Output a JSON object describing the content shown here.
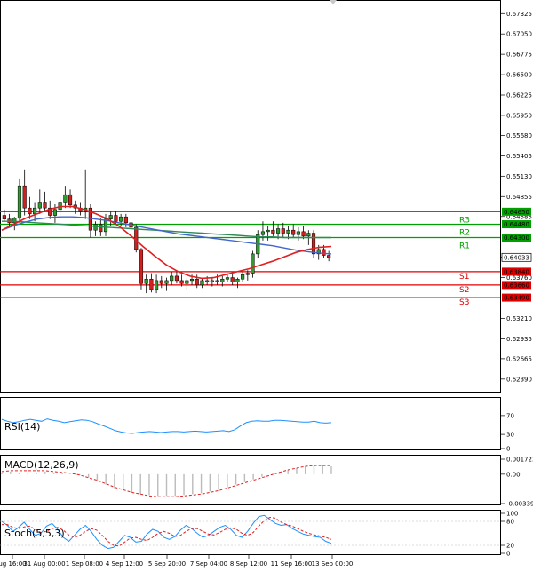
{
  "chart_data": {
    "type": "candlestick",
    "main": {
      "y_ticks": [
        "0.67325",
        "0.67050",
        "0.66775",
        "0.66500",
        "0.66225",
        "0.65950",
        "0.65680",
        "0.65405",
        "0.65130",
        "0.64855",
        "0.64585",
        "0.64035",
        "0.63760",
        "0.63210",
        "0.62935",
        "0.62665",
        "0.62390"
      ],
      "ylim": [
        0.6228,
        0.6746
      ],
      "x_ticks": [
        "ug 16:00",
        "31 Aug 00:00",
        "1 Sep 08:00",
        "4 Sep 12:00",
        "5 Sep 20:00",
        "7 Sep 04:00",
        "8 Sep 12:00",
        "11 Sep 16:00",
        "13 Sep 00:00"
      ],
      "last_price": "0.64033",
      "candles": [
        [
          0.646,
          0.6468,
          0.6452,
          0.6455
        ],
        [
          0.6455,
          0.6462,
          0.6446,
          0.645
        ],
        [
          0.645,
          0.6458,
          0.644,
          0.6456
        ],
        [
          0.6456,
          0.651,
          0.645,
          0.65
        ],
        [
          0.65,
          0.6522,
          0.646,
          0.647
        ],
        [
          0.647,
          0.6485,
          0.6455,
          0.6462
        ],
        [
          0.6462,
          0.6478,
          0.6452,
          0.647
        ],
        [
          0.647,
          0.6495,
          0.6462,
          0.6478
        ],
        [
          0.6478,
          0.6492,
          0.6465,
          0.647
        ],
        [
          0.647,
          0.648,
          0.6455,
          0.646
        ],
        [
          0.646,
          0.6475,
          0.645,
          0.6468
        ],
        [
          0.6468,
          0.6485,
          0.646,
          0.6478
        ],
        [
          0.6478,
          0.65,
          0.647,
          0.6488
        ],
        [
          0.6488,
          0.6495,
          0.647,
          0.6474
        ],
        [
          0.6474,
          0.648,
          0.6462,
          0.647
        ],
        [
          0.647,
          0.6478,
          0.646,
          0.6465
        ],
        [
          0.6465,
          0.6522,
          0.6455,
          0.647
        ],
        [
          0.647,
          0.6475,
          0.643,
          0.644
        ],
        [
          0.644,
          0.6452,
          0.6432,
          0.6448
        ],
        [
          0.6448,
          0.6456,
          0.6432,
          0.6438
        ],
        [
          0.6438,
          0.6462,
          0.6432,
          0.6455
        ],
        [
          0.6455,
          0.6465,
          0.6445,
          0.646
        ],
        [
          0.646,
          0.6466,
          0.6448,
          0.6452
        ],
        [
          0.6452,
          0.6462,
          0.6446,
          0.6458
        ],
        [
          0.6458,
          0.6462,
          0.6444,
          0.645
        ],
        [
          0.645,
          0.6455,
          0.6438,
          0.6444
        ],
        [
          0.6444,
          0.6448,
          0.641,
          0.6414
        ],
        [
          0.6414,
          0.6416,
          0.636,
          0.6368
        ],
        [
          0.6368,
          0.638,
          0.6355,
          0.6374
        ],
        [
          0.6374,
          0.6382,
          0.6356,
          0.636
        ],
        [
          0.636,
          0.638,
          0.6355,
          0.6372
        ],
        [
          0.6372,
          0.6378,
          0.6362,
          0.6368
        ],
        [
          0.6368,
          0.6376,
          0.6358,
          0.6372
        ],
        [
          0.6372,
          0.6384,
          0.6366,
          0.6378
        ],
        [
          0.6378,
          0.6384,
          0.6368,
          0.6372
        ],
        [
          0.6372,
          0.638,
          0.6364,
          0.6368
        ],
        [
          0.6368,
          0.6376,
          0.636,
          0.6372
        ],
        [
          0.6372,
          0.638,
          0.6366,
          0.6374
        ],
        [
          0.6374,
          0.638,
          0.6362,
          0.6366
        ],
        [
          0.6366,
          0.6376,
          0.6362,
          0.6372
        ],
        [
          0.6372,
          0.6378,
          0.6366,
          0.637
        ],
        [
          0.637,
          0.6376,
          0.6364,
          0.6372
        ],
        [
          0.6372,
          0.638,
          0.6366,
          0.637
        ],
        [
          0.637,
          0.6378,
          0.6364,
          0.6374
        ],
        [
          0.6374,
          0.638,
          0.637,
          0.6376
        ],
        [
          0.6376,
          0.6382,
          0.6366,
          0.637
        ],
        [
          0.637,
          0.6376,
          0.6362,
          0.6374
        ],
        [
          0.6374,
          0.6384,
          0.637,
          0.638
        ],
        [
          0.638,
          0.6386,
          0.6372,
          0.6382
        ],
        [
          0.6382,
          0.6412,
          0.6376,
          0.6408
        ],
        [
          0.6408,
          0.644,
          0.6402,
          0.6434
        ],
        [
          0.6434,
          0.6452,
          0.6426,
          0.6438
        ],
        [
          0.6438,
          0.6446,
          0.6426,
          0.644
        ],
        [
          0.644,
          0.6452,
          0.6432,
          0.6436
        ],
        [
          0.6436,
          0.6448,
          0.6428,
          0.6442
        ],
        [
          0.6442,
          0.645,
          0.643,
          0.6436
        ],
        [
          0.6436,
          0.6446,
          0.6428,
          0.644
        ],
        [
          0.644,
          0.6448,
          0.643,
          0.6434
        ],
        [
          0.6434,
          0.6444,
          0.6426,
          0.6438
        ],
        [
          0.6438,
          0.6446,
          0.6428,
          0.6432
        ],
        [
          0.6432,
          0.644,
          0.642,
          0.6436
        ],
        [
          0.6436,
          0.644,
          0.6402,
          0.6408
        ],
        [
          0.6408,
          0.642,
          0.64,
          0.6414
        ],
        [
          0.6414,
          0.642,
          0.6402,
          0.6406
        ],
        [
          0.6406,
          0.6412,
          0.6398,
          0.6403
        ]
      ],
      "sma_red": [
        0.644,
        0.6448,
        0.6456,
        0.6462,
        0.6468,
        0.6472,
        0.6472,
        0.6468,
        0.6462,
        0.6455,
        0.6445,
        0.6432,
        0.6418,
        0.6405,
        0.6393,
        0.6384,
        0.6378,
        0.6375,
        0.6376,
        0.638,
        0.6384,
        0.6388,
        0.6393,
        0.6398,
        0.6404,
        0.641,
        0.6414,
        0.6417,
        0.6418
      ],
      "sma_blue": [
        0.644,
        0.6446,
        0.6451,
        0.6455,
        0.6457,
        0.6458,
        0.6458,
        0.6457,
        0.6455,
        0.6453,
        0.645,
        0.6447,
        0.6444,
        0.6441,
        0.6438,
        0.6435,
        0.6433,
        0.6431,
        0.6429,
        0.6427,
        0.6425,
        0.6423,
        0.6421,
        0.6419,
        0.6416,
        0.6413,
        0.6411,
        0.6409,
        0.6408
      ],
      "sma_green": [
        0.6452,
        0.6452,
        0.6451,
        0.645,
        0.6449,
        0.6448,
        0.6447,
        0.6446,
        0.6445,
        0.6444,
        0.6443,
        0.6442,
        0.6441,
        0.644,
        0.6439,
        0.6438,
        0.6437,
        0.6436,
        0.6435,
        0.6434,
        0.6433,
        0.6432,
        0.6431,
        0.6431,
        0.643,
        0.643,
        0.643,
        0.643,
        0.643
      ],
      "levels": [
        {
          "name": "R3",
          "value": 0.6465,
          "tag": "0.64650",
          "color": "#00a000"
        },
        {
          "name": "R2",
          "value": 0.6448,
          "tag": "0.64480",
          "color": "#00a000"
        },
        {
          "name": "R1",
          "value": 0.643,
          "tag": "0.64300",
          "color": "#00a000"
        },
        {
          "name": "S1",
          "value": 0.6384,
          "tag": "0.63840",
          "color": "#e00000"
        },
        {
          "name": "S2",
          "value": 0.6366,
          "tag": "0.63660",
          "color": "#e00000"
        },
        {
          "name": "S3",
          "value": 0.6349,
          "tag": "0.63490",
          "color": "#e00000"
        }
      ]
    },
    "rsi": {
      "label": "RSI(14)",
      "ticks": [
        "70",
        "30",
        "0"
      ],
      "tick_values": [
        70,
        30,
        0
      ],
      "ylim": [
        0,
        100
      ],
      "values": [
        62,
        58,
        55,
        57,
        60,
        62,
        60,
        58,
        63,
        60,
        58,
        55,
        57,
        59,
        61,
        60,
        57,
        52,
        48,
        43,
        38,
        35,
        33,
        32,
        34,
        35,
        36,
        35,
        34,
        35,
        36,
        36,
        35,
        36,
        37,
        36,
        35,
        36,
        37,
        38,
        36,
        40,
        48,
        55,
        58,
        59,
        58,
        58,
        60,
        60,
        59,
        58,
        57,
        56,
        56,
        58,
        55,
        54,
        55
      ]
    },
    "macd": {
      "label": "MACD(12,26,9)",
      "ticks": [
        "0.001723",
        "0.00",
        "-0.003392"
      ],
      "ylim": [
        -0.003392,
        0.001723
      ],
      "histogram": [
        0.0002,
        0.0003,
        0.0002,
        0.0001,
        0.0002,
        0.0003,
        0.0002,
        0.0001,
        0.0,
        -0.0001,
        -0.0004,
        -0.0008,
        -0.0012,
        -0.0016,
        -0.0019,
        -0.0021,
        -0.0023,
        -0.0024,
        -0.0025,
        -0.0025,
        -0.0025,
        -0.0024,
        -0.0023,
        -0.0022,
        -0.002,
        -0.0018,
        -0.0015,
        -0.0012,
        -0.0009,
        -0.0006,
        -0.0003,
        0.0,
        0.0003,
        0.0005,
        0.0007,
        0.0009,
        0.001,
        0.001,
        0.0009
      ],
      "signal": [
        0.0003,
        0.0004,
        0.0004,
        0.0004,
        0.0004,
        0.0004,
        0.0003,
        0.0002,
        0.0001,
        -0.0001,
        -0.0004,
        -0.0007,
        -0.0011,
        -0.0015,
        -0.0018,
        -0.0021,
        -0.0023,
        -0.0025,
        -0.0026,
        -0.0026,
        -0.0026,
        -0.0025,
        -0.0024,
        -0.0023,
        -0.0021,
        -0.0019,
        -0.0016,
        -0.0013,
        -0.001,
        -0.0007,
        -0.0004,
        -0.0001,
        0.0002,
        0.0005,
        0.0007,
        0.0009,
        0.001,
        0.001,
        0.001
      ]
    },
    "stoch": {
      "label": "Stoch(5,5,3)",
      "ticks": [
        "100",
        "80",
        "20",
        "0"
      ],
      "tick_values": [
        100,
        80,
        20,
        0
      ],
      "ylim": [
        0,
        100
      ],
      "main": [
        80,
        70,
        55,
        65,
        78,
        60,
        45,
        50,
        68,
        75,
        60,
        40,
        30,
        45,
        60,
        70,
        55,
        35,
        20,
        12,
        15,
        30,
        45,
        40,
        28,
        30,
        48,
        60,
        55,
        40,
        35,
        42,
        58,
        70,
        62,
        50,
        40,
        45,
        55,
        65,
        70,
        60,
        45,
        40,
        55,
        75,
        92,
        95,
        85,
        75,
        70,
        72,
        62,
        55,
        48,
        45,
        42,
        40,
        30,
        25
      ],
      "signal": [
        72,
        72,
        65,
        62,
        66,
        68,
        60,
        52,
        55,
        62,
        65,
        58,
        46,
        40,
        45,
        55,
        62,
        58,
        45,
        30,
        20,
        18,
        28,
        38,
        40,
        35,
        32,
        40,
        50,
        55,
        50,
        42,
        45,
        55,
        62,
        62,
        55,
        48,
        46,
        52,
        60,
        64,
        60,
        50,
        45,
        52,
        68,
        82,
        90,
        88,
        78,
        72,
        68,
        62,
        55,
        50,
        46,
        43,
        40,
        35
      ]
    }
  }
}
